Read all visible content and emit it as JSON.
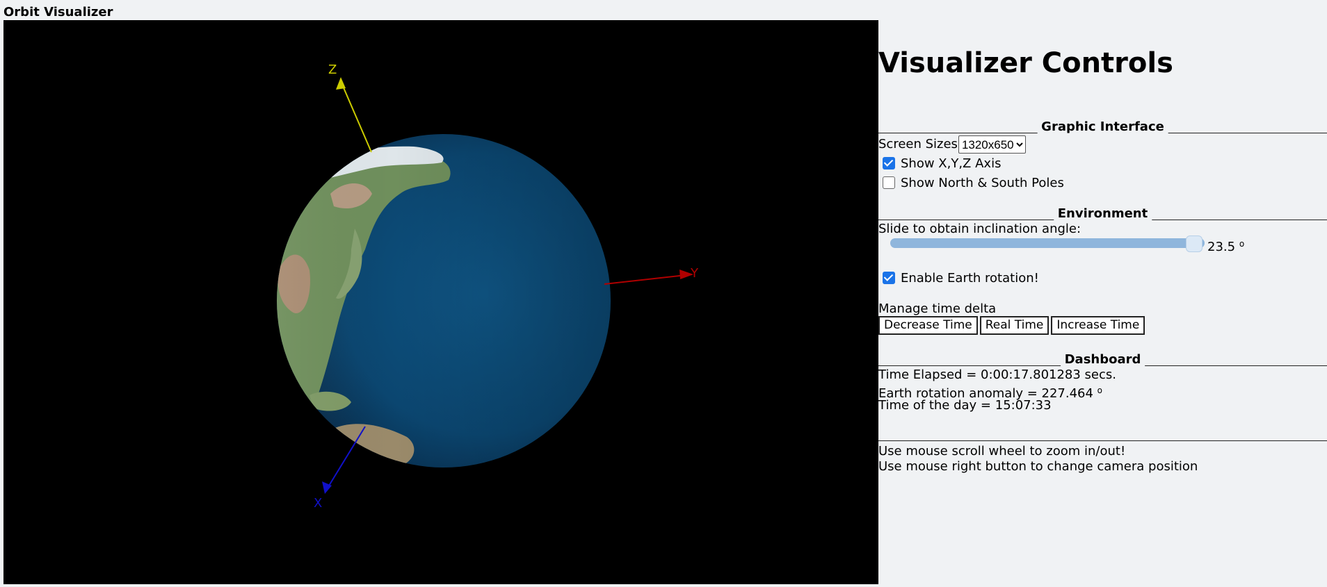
{
  "app": {
    "title": "Orbit Visualizer"
  },
  "viewport": {
    "axes": {
      "x": "X",
      "y": "Y",
      "z": "Z"
    },
    "colors": {
      "x_axis": "#1010c8",
      "y_axis": "#b00000",
      "z_axis": "#cccc00",
      "ocean": "#0d4a74",
      "land": "#6a8a55"
    }
  },
  "panel": {
    "title": "Visualizer Controls",
    "graphic_interface": {
      "heading": "Graphic Interface",
      "screen_sizes_label": "Screen Sizes",
      "screen_size_value": "1320x650",
      "show_axis_label": "Show X,Y,Z Axis",
      "show_axis_checked": true,
      "show_poles_label": "Show North & South Poles",
      "show_poles_checked": false
    },
    "environment": {
      "heading": "Environment",
      "slider_label": "Slide to obtain inclination angle:",
      "inclination_value": "23.5",
      "degree_symbol": "o",
      "enable_rotation_label": "Enable Earth rotation!",
      "enable_rotation_checked": true,
      "time_delta_label": "Manage time delta",
      "decrease_label": "Decrease Time",
      "real_time_label": "Real Time",
      "increase_label": "Increase Time"
    },
    "dashboard": {
      "heading": "Dashboard",
      "time_elapsed": "Time Elapsed = 0:00:17.801283 secs.",
      "rotation_anomaly": "Earth rotation anomaly = 227.464",
      "degree_symbol": "o",
      "time_of_day": "Time of the day = 15:07:33"
    },
    "help": {
      "zoom": "Use mouse scroll wheel to zoom in/out!",
      "camera": "Use mouse right button to change camera position"
    }
  }
}
